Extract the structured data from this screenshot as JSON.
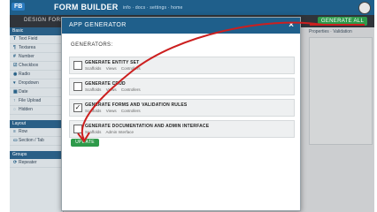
{
  "header": {
    "logo_text": "FB",
    "brand": "FORM BUILDER",
    "brand_sub": "info  ·  docs  ·  settings  ·  home"
  },
  "subbar": {
    "tab": "DESIGN FORM",
    "generate_label": "GENERATE ALL"
  },
  "sidebar": {
    "sections": [
      {
        "title": "Basic",
        "items": [
          "Text Field",
          "Textarea",
          "Number",
          "Checkbox",
          "Radio",
          "Dropdown",
          "Date",
          "File Upload",
          "Hidden"
        ]
      },
      {
        "title": "Layout",
        "items": [
          "Row",
          "Section / Tab"
        ]
      },
      {
        "title": "Groups",
        "items": [
          "Repeater"
        ]
      }
    ]
  },
  "right_panel": {
    "links": "Properties  ·  Validation"
  },
  "modal": {
    "title": "APP GENERATOR",
    "close": "×",
    "section_label": "GENERATORS:",
    "generators": [
      {
        "title": "GENERATE ENTITY SET",
        "meta": [
          "Scaffolds",
          "Views",
          "Controllers"
        ],
        "checked": false
      },
      {
        "title": "GENERATE CRUD",
        "meta": [
          "Scaffolds",
          "Views",
          "Controllers"
        ],
        "checked": false
      },
      {
        "title": "GENERATE FORMS AND VALIDATION RULES",
        "meta": [
          "Scaffolds",
          "Views",
          "Controllers"
        ],
        "checked": true
      },
      {
        "title": "GENERATE DOCUMENTATION AND ADMIN INTERFACE",
        "meta": [
          "Scaffolds",
          "Admin Interface"
        ],
        "checked": false
      }
    ],
    "update_label": "UPDATE"
  },
  "annotation_color": "#cc1f1f"
}
